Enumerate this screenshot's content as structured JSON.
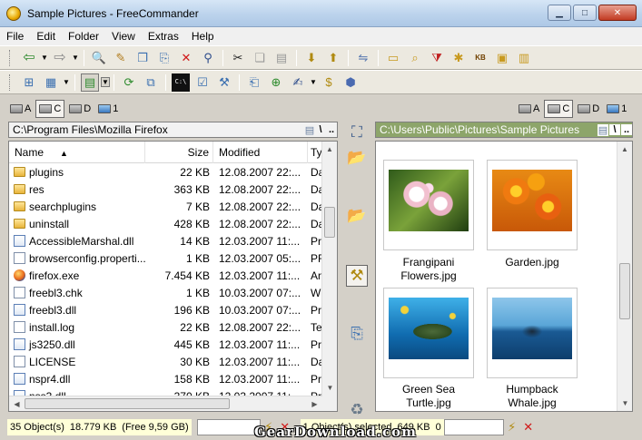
{
  "window": {
    "title": "Sample Pictures - FreeCommander"
  },
  "menu": [
    "File",
    "Edit",
    "Folder",
    "View",
    "Extras",
    "Help"
  ],
  "left_drives": [
    {
      "letter": "A",
      "active": false
    },
    {
      "letter": "C",
      "active": true
    },
    {
      "letter": "D",
      "active": false
    },
    {
      "letter": "1",
      "active": false
    }
  ],
  "right_drives": [
    {
      "letter": "A",
      "active": false
    },
    {
      "letter": "C",
      "active": true
    },
    {
      "letter": "D",
      "active": false
    },
    {
      "letter": "1",
      "active": false
    }
  ],
  "left_panel": {
    "path": "C:\\Program Files\\Mozilla Firefox",
    "columns": {
      "name": "Name",
      "size": "Size",
      "modified": "Modified",
      "type": "Ty"
    },
    "files": [
      {
        "name": "plugins",
        "size": "22 KB",
        "modified": "12.08.2007 22:...",
        "type": "Da",
        "icon": "folder"
      },
      {
        "name": "res",
        "size": "363 KB",
        "modified": "12.08.2007 22:...",
        "type": "Da",
        "icon": "folder"
      },
      {
        "name": "searchplugins",
        "size": "7 KB",
        "modified": "12.08.2007 22:...",
        "type": "Da",
        "icon": "folder"
      },
      {
        "name": "uninstall",
        "size": "428 KB",
        "modified": "12.08.2007 22:...",
        "type": "Da",
        "icon": "folder"
      },
      {
        "name": "AccessibleMarshal.dll",
        "size": "14 KB",
        "modified": "12.03.2007 11:...",
        "type": "Pr",
        "icon": "dll"
      },
      {
        "name": "browserconfig.properti...",
        "size": "1 KB",
        "modified": "12.03.2007 05:...",
        "type": "PF",
        "icon": "file"
      },
      {
        "name": "firefox.exe",
        "size": "7.454 KB",
        "modified": "12.03.2007 11:...",
        "type": "An",
        "icon": "exe"
      },
      {
        "name": "freebl3.chk",
        "size": "1 KB",
        "modified": "10.03.2007 07:...",
        "type": "Wi",
        "icon": "file"
      },
      {
        "name": "freebl3.dll",
        "size": "196 KB",
        "modified": "10.03.2007 07:...",
        "type": "Pr",
        "icon": "dll"
      },
      {
        "name": "install.log",
        "size": "22 KB",
        "modified": "12.08.2007 22:...",
        "type": "Te",
        "icon": "file"
      },
      {
        "name": "js3250.dll",
        "size": "445 KB",
        "modified": "12.03.2007 11:...",
        "type": "Pr",
        "icon": "dll"
      },
      {
        "name": "LICENSE",
        "size": "30 KB",
        "modified": "12.03.2007 11:...",
        "type": "Da",
        "icon": "file"
      },
      {
        "name": "nspr4.dll",
        "size": "158 KB",
        "modified": "12.03.2007 11:...",
        "type": "Pr",
        "icon": "dll"
      },
      {
        "name": "nss3.dll",
        "size": "370 KB",
        "modified": "12.03.2007 11:...",
        "type": "Pr",
        "icon": "dll"
      }
    ]
  },
  "right_panel": {
    "path": "C:\\Users\\Public\\Pictures\\Sample Pictures",
    "thumbnails": [
      {
        "caption_line1": "Frangipani",
        "caption_line2": "Flowers.jpg",
        "image": "frangipani-flowers"
      },
      {
        "caption_line1": "Garden.jpg",
        "caption_line2": "",
        "image": "garden-flowers"
      },
      {
        "caption_line1": "Green Sea",
        "caption_line2": "Turtle.jpg",
        "image": "sea-turtle"
      },
      {
        "caption_line1": "Humpback",
        "caption_line2": "Whale.jpg",
        "image": "whale-tail"
      }
    ]
  },
  "path_buttons": [
    "\\",
    ".."
  ],
  "status": {
    "left_objects": "35 Object(s)",
    "left_size": "18.779 KB",
    "left_free": "(Free 9,59 GB)",
    "right_selected": "1 Object(s) selected",
    "right_size": "649 KB",
    "right_extra": "0"
  },
  "watermark": "GearDownload.com",
  "colors": {
    "right_path_bg": "#8da56a",
    "left_path_bg": "#f2f2f2",
    "status_bg": "#ffffd8"
  }
}
